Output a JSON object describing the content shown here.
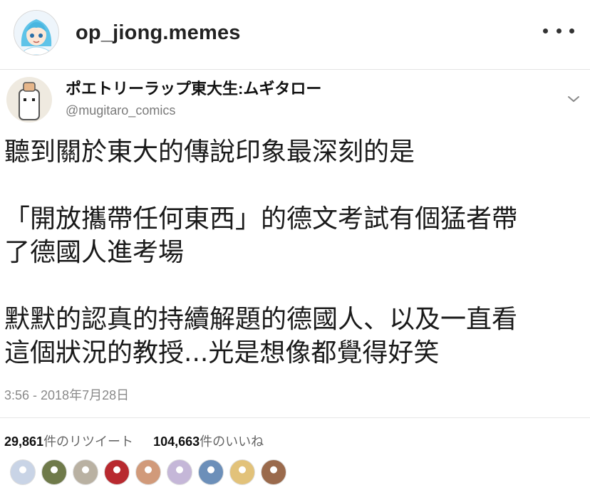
{
  "instagram": {
    "username": "op_jiong.memes"
  },
  "tweet": {
    "display_name": "ポエトリーラップ東大生:ムギタロー",
    "handle": "@mugitaro_comics",
    "lines": [
      "聽到關於東大的傳說印象最深刻的是",
      "",
      "「開放攜帶任何東西」的德文考試有個猛者帶",
      "了德國人進考場",
      "",
      "默默的認真的持續解題的德國人、以及一直看",
      "這個狀況的教授...光是想像都覺得好笑"
    ],
    "timestamp": "3:56 - 2018年7月28日",
    "retweets_count": "29,861",
    "retweets_label": "件のリツイート",
    "likes_count": "104,663",
    "likes_label": "件のいいね"
  },
  "colors": {
    "liker_avatars": [
      "#c9d4e6",
      "#6f7a4a",
      "#b9b1a2",
      "#b8292f",
      "#d19a7a",
      "#c5b7d8",
      "#6c8fb9",
      "#e2c27a",
      "#9a6a4c"
    ]
  }
}
